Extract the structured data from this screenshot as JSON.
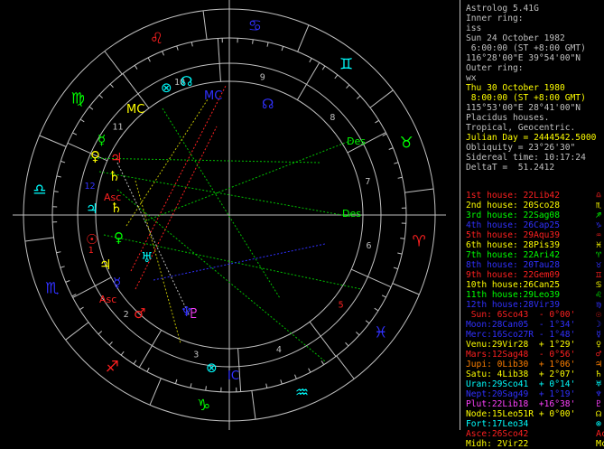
{
  "app": {
    "title": "Astrolog 5.41G"
  },
  "colors": {
    "bg": "#000000",
    "text": "#c0c0c0",
    "yellow": "#ffff00",
    "red": "#ff2020",
    "green": "#00ff00",
    "blue": "#3030ff",
    "cyan": "#00ffff",
    "magenta": "#ff40ff",
    "orange": "#ff8000"
  },
  "info": {
    "inner_ring_label": "Inner ring:",
    "inner_name": "iss",
    "inner_date": "Sun 24 October 1982",
    "inner_time": " 6:00:00 (ST +8:00 GMT)",
    "inner_coords": "116°28'00\"E 39°54'00\"N",
    "outer_ring_label": "Outer ring:",
    "outer_name": "wx",
    "outer_date": "Thu 30 October 1980",
    "outer_time": " 8:00:00 (ST +8:00 GMT)",
    "outer_coords": "115°53'00\"E 28°41'00\"N",
    "house_system": "Placidus houses.",
    "zodiac": "Tropical, Geocentric.",
    "julian": "Julian Day = 2444542.5000",
    "obliquity": "Obliquity = 23°26'30\"",
    "sidereal": "Sidereal time: 10:17:24",
    "deltat": "DeltaT =  51.2412"
  },
  "houses": [
    {
      "label": "1st house:",
      "value": "22Lib42",
      "color": "#ff2020",
      "glyph": "♎"
    },
    {
      "label": "2nd house:",
      "value": "20Sco28",
      "color": "#ffff00",
      "glyph": "♏"
    },
    {
      "label": "3rd house:",
      "value": "22Sag08",
      "color": "#00ff00",
      "glyph": "♐"
    },
    {
      "label": "4th house:",
      "value": "26Cap25",
      "color": "#3030ff",
      "glyph": "♑"
    },
    {
      "label": "5th house:",
      "value": "29Aqu39",
      "color": "#ff2020",
      "glyph": "♒"
    },
    {
      "label": "6th house:",
      "value": "28Pis39",
      "color": "#ffff00",
      "glyph": "♓"
    },
    {
      "label": "7th house:",
      "value": "22Ari42",
      "color": "#00ff00",
      "glyph": "♈"
    },
    {
      "label": "8th house:",
      "value": "20Tau28",
      "color": "#3030ff",
      "glyph": "♉"
    },
    {
      "label": "9th house:",
      "value": "22Gem09",
      "color": "#ff2020",
      "glyph": "♊"
    },
    {
      "label": "10th house:",
      "value": "26Can25",
      "color": "#ffff00",
      "glyph": "♋"
    },
    {
      "label": "11th house:",
      "value": "29Leo39",
      "color": "#00ff00",
      "glyph": "♌"
    },
    {
      "label": "12th house:",
      "value": "28Vir39",
      "color": "#3030ff",
      "glyph": "♍"
    }
  ],
  "planets": [
    {
      "name": "Sun:",
      "value": " 6Sco43",
      "motion": " - 0°00'",
      "color": "#ff2020",
      "glyph": "☉"
    },
    {
      "name": "Moon:",
      "value": "28Can05",
      "motion": " - 1°34'",
      "color": "#3030ff",
      "glyph": "☽"
    },
    {
      "name": "Merc:",
      "value": "16Sco27R",
      "motion": " - 1°48'",
      "color": "#3030ff",
      "glyph": "☿"
    },
    {
      "name": "Venu:",
      "value": "29Vir28",
      "motion": " + 1°29'",
      "color": "#ffff00",
      "glyph": "♀"
    },
    {
      "name": "Mars:",
      "value": "12Sag48",
      "motion": " - 0°56'",
      "color": "#ff2020",
      "glyph": "♂"
    },
    {
      "name": "Jupi:",
      "value": " 0Lib30",
      "motion": " + 1°06'",
      "color": "#ff8000",
      "glyph": "♃"
    },
    {
      "name": "Satu:",
      "value": " 4Lib38",
      "motion": " + 2°07'",
      "color": "#ffff00",
      "glyph": "♄"
    },
    {
      "name": "Uran:",
      "value": "29Sco41",
      "motion": " + 0°14'",
      "color": "#00ffff",
      "glyph": "♅"
    },
    {
      "name": "Nept:",
      "value": "20Sag49",
      "motion": " + 1°19'",
      "color": "#3030ff",
      "glyph": "♆"
    },
    {
      "name": "Plut:",
      "value": "22Lib18",
      "motion": " +16°38'",
      "color": "#ff40ff",
      "glyph": "♇"
    },
    {
      "name": "Node:",
      "value": "15Leo51R",
      "motion": " + 0°00'",
      "color": "#ffff00",
      "glyph": "☊"
    },
    {
      "name": "Fort:",
      "value": "17Leo34",
      "motion": "",
      "color": "#00ffff",
      "glyph": "⊗"
    },
    {
      "name": "Asce:",
      "value": "26Sco42",
      "motion": "",
      "color": "#ff2020",
      "glyph": "Ac"
    },
    {
      "name": "Midh:",
      "value": " 2Vir22",
      "motion": "",
      "color": "#ffff00",
      "glyph": "Mc"
    }
  ],
  "wheel": {
    "zodiac_glyphs": [
      "♈",
      "♉",
      "♊",
      "♋",
      "♌",
      "♍",
      "♎",
      "♏",
      "♐",
      "♑",
      "♒",
      "♓"
    ],
    "house_numbers": [
      "1",
      "2",
      "3",
      "4",
      "5",
      "6",
      "7",
      "8",
      "9",
      "10",
      "11",
      "12"
    ],
    "asc_left": "Asc",
    "dsc_right": "Des",
    "mc_label": "MC",
    "ic_label": "IC"
  }
}
